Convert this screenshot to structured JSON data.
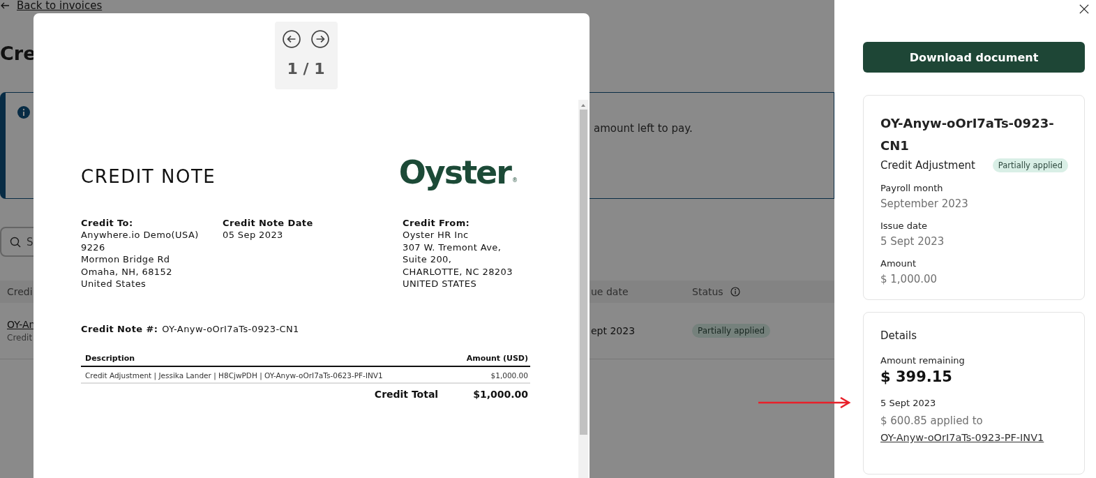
{
  "background_page": {
    "back_link": "Back to invoices",
    "title": "Cre",
    "banner": {
      "text": "amount left to pay."
    },
    "search": {
      "placeholder": "S"
    },
    "table": {
      "columns": [
        "Credi",
        "ue date",
        "Status"
      ],
      "rows": [
        {
          "number": "OY-An",
          "type": "Credit",
          "date": "ept 2023",
          "status": "Partially applied"
        }
      ]
    }
  },
  "viewer": {
    "page_counter": "1 / 1",
    "document": {
      "title": "CREDIT NOTE",
      "logo": "Oyster",
      "logo_mark": "®",
      "parties": [
        {
          "heading": "Credit To:",
          "lines": [
            "Anywhere.io Demo(USA)",
            "9226",
            "Mormon Bridge Rd",
            "Omaha, NH, 68152",
            "United States"
          ]
        },
        {
          "heading": "Credit Note Date",
          "lines": [
            "05 Sep 2023"
          ]
        },
        {
          "heading": "Credit From:",
          "lines": [
            "Oyster HR Inc",
            "307 W. Tremont Ave,",
            "Suite 200,",
            "CHARLOTTE, NC 28203",
            "UNITED STATES"
          ]
        }
      ],
      "number_label": "Credit Note #:",
      "number": "OY-Anyw-oOrI7aTs-0923-CN1",
      "table": {
        "columns": [
          "Description",
          "Amount (USD)"
        ],
        "rows": [
          [
            "Credit Adjustment | Jessika Lander | H8CjwPDH | OY-Anyw-oOrI7aTs-0623-PF-INV1",
            "$1,000.00"
          ]
        ],
        "total_label": "Credit Total",
        "total": "$1,000.00"
      }
    }
  },
  "drawer": {
    "download_button": "Download document",
    "summary": {
      "title": "OY-Anyw-oOrI7aTs-0923-CN1",
      "type": "Credit Adjustment",
      "status": "Partially applied",
      "fields": [
        {
          "label": "Payroll month",
          "value": "September 2023"
        },
        {
          "label": "Issue date",
          "value": "5 Sept 2023"
        },
        {
          "label": "Amount",
          "value": "$ 1,000.00"
        }
      ]
    },
    "details": {
      "heading": "Details",
      "remaining_label": "Amount remaining",
      "remaining": "$ 399.15",
      "applications": [
        {
          "date": "5 Sept 2023",
          "text": "$ 600.85 applied to ",
          "link": "OY-Anyw-oOrI7aTs-0923-PF-INV1"
        }
      ]
    }
  },
  "annotation": {
    "kind": "arrow"
  }
}
